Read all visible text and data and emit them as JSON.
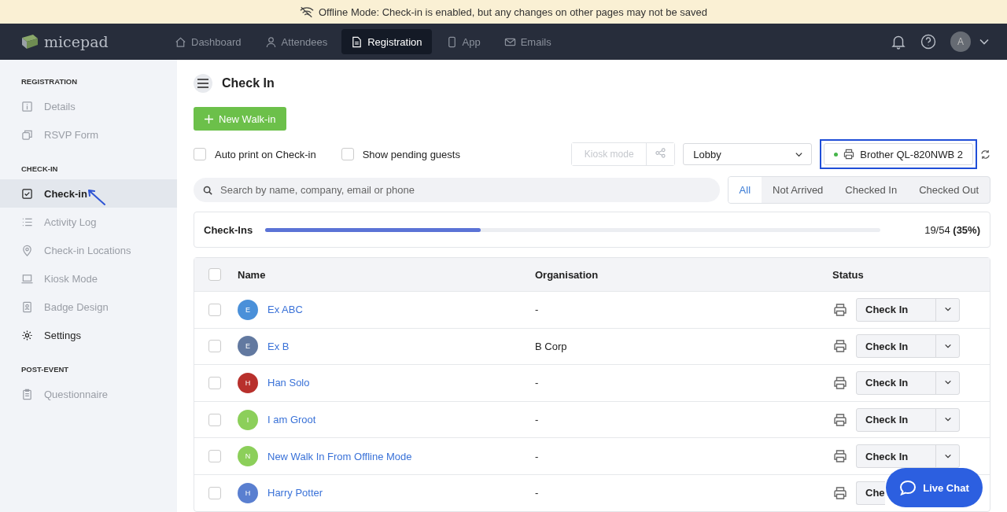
{
  "banner": {
    "text": "Offline Mode: Check-in is enabled, but any changes on other pages may not be saved"
  },
  "nav": {
    "logo": "micepad",
    "items": [
      {
        "label": "Dashboard",
        "selected": false
      },
      {
        "label": "Attendees",
        "selected": false
      },
      {
        "label": "Registration",
        "selected": true
      },
      {
        "label": "App",
        "selected": false
      },
      {
        "label": "Emails",
        "selected": false
      }
    ],
    "avatar": "A"
  },
  "sidebar": {
    "sections": [
      {
        "title": "REGISTRATION",
        "items": [
          {
            "label": "Details",
            "selected": false,
            "disabled": true
          },
          {
            "label": "RSVP Form",
            "selected": false,
            "disabled": true
          }
        ]
      },
      {
        "title": "CHECK-IN",
        "items": [
          {
            "label": "Check-in",
            "selected": true,
            "disabled": false
          },
          {
            "label": "Activity Log",
            "selected": false,
            "disabled": true
          },
          {
            "label": "Check-in Locations",
            "selected": false,
            "disabled": true
          },
          {
            "label": "Kiosk Mode",
            "selected": false,
            "disabled": true
          },
          {
            "label": "Badge Design",
            "selected": false,
            "disabled": true
          },
          {
            "label": "Settings",
            "selected": false,
            "disabled": false
          }
        ]
      },
      {
        "title": "POST-EVENT",
        "items": [
          {
            "label": "Questionnaire",
            "selected": false,
            "disabled": true
          }
        ]
      }
    ]
  },
  "page": {
    "title": "Check In",
    "new_button": "New Walk-in",
    "options": [
      {
        "label": "Auto print on Check-in",
        "checked": false
      },
      {
        "label": "Show pending guests",
        "checked": false
      }
    ],
    "kiosk_button": {
      "label": "Kiosk mode",
      "disabled": true
    },
    "location": {
      "value": "Lobby"
    },
    "printer": {
      "label": "Brother QL-820NWB 2",
      "online": true
    },
    "search": {
      "placeholder": "Search by name, company, email or phone"
    },
    "filters": [
      {
        "label": "All",
        "selected": true
      },
      {
        "label": "Not Arrived",
        "selected": false
      },
      {
        "label": "Checked In",
        "selected": false
      },
      {
        "label": "Checked Out",
        "selected": false
      }
    ],
    "progress": {
      "label": "Check-Ins",
      "level": 0.35,
      "count": "19/54",
      "percent": "(35%)"
    }
  },
  "table": {
    "columns": [
      "Name",
      "Organisation",
      "Status"
    ],
    "header_checked": false,
    "rows": [
      {
        "initial": "E",
        "color": "#4a90d9",
        "name": "Ex ABC",
        "organisation": "-",
        "status": "Check In",
        "checked": false
      },
      {
        "initial": "E",
        "color": "#6279a0",
        "name": "Ex B",
        "organisation": "B Corp",
        "status": "Check In",
        "checked": false
      },
      {
        "initial": "H",
        "color": "#b8302c",
        "name": "Han Solo",
        "organisation": "-",
        "status": "Check In",
        "checked": false
      },
      {
        "initial": "I",
        "color": "#8ccf5a",
        "name": "I am Groot",
        "organisation": "-",
        "status": "Check In",
        "checked": false
      },
      {
        "initial": "N",
        "color": "#8ccf5a",
        "name": "New Walk In From Offline Mode",
        "organisation": "-",
        "status": "Check In",
        "checked": false
      },
      {
        "initial": "H",
        "color": "#5a7fd0",
        "name": "Harry Potter",
        "organisation": "-",
        "status": "Che",
        "checked": false
      }
    ]
  },
  "live_chat": "Live Chat"
}
